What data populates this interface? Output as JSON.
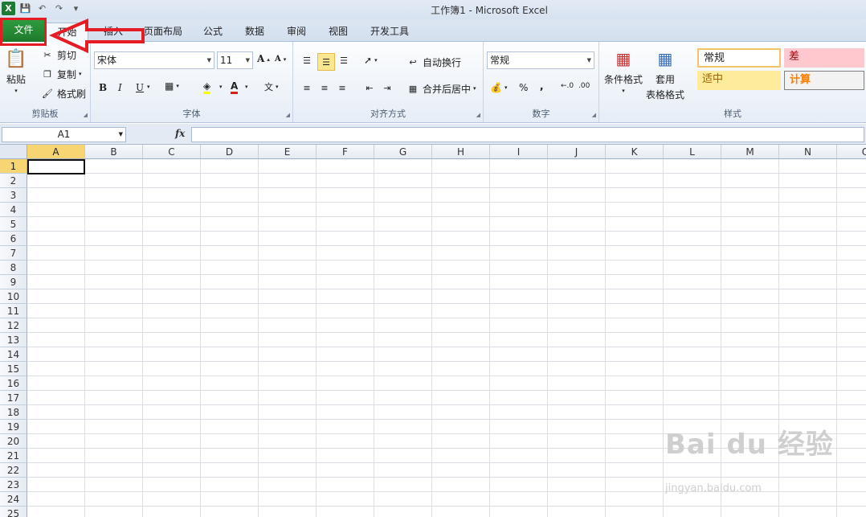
{
  "window": {
    "title": "工作簿1 - Microsoft Excel"
  },
  "tabs": [
    "文件",
    "开始",
    "插入",
    "页面布局",
    "公式",
    "数据",
    "审阅",
    "视图",
    "开发工具"
  ],
  "clipboard": {
    "paste": "粘贴",
    "cut": "剪切",
    "copy": "复制",
    "format_painter": "格式刷",
    "label": "剪贴板"
  },
  "font": {
    "name": "宋体",
    "size": "11",
    "bold": "B",
    "italic": "I",
    "underline": "U",
    "label": "字体"
  },
  "alignment": {
    "wrap": "自动换行",
    "merge": "合并后居中",
    "label": "对齐方式"
  },
  "number": {
    "format": "常规",
    "percent": "%",
    "comma": ",",
    "label": "数字"
  },
  "styles": {
    "conditional": "条件格式",
    "table_line1": "套用",
    "table_line2": "表格格式",
    "normal": "常规",
    "bad": "差",
    "neutral": "适中",
    "calc": "计算",
    "label": "样式"
  },
  "formula_bar": {
    "name_box": "A1",
    "fx": "fx",
    "value": ""
  },
  "columns": [
    "A",
    "B",
    "C",
    "D",
    "E",
    "F",
    "G",
    "H",
    "I",
    "J",
    "K",
    "L",
    "M",
    "N",
    "O"
  ],
  "rows": [
    "1",
    "2",
    "3",
    "4",
    "5",
    "6",
    "7",
    "8",
    "9",
    "10",
    "11",
    "12",
    "13",
    "14",
    "15",
    "16",
    "17",
    "18",
    "19",
    "20",
    "21",
    "22",
    "23",
    "24",
    "25"
  ],
  "watermark": {
    "logo": "Bai du 经验",
    "url": "jingyan.baidu.com"
  },
  "colors": {
    "file_tab": "#2a8c39",
    "annotation": "#e51c23",
    "selected_header": "#f8d573"
  }
}
